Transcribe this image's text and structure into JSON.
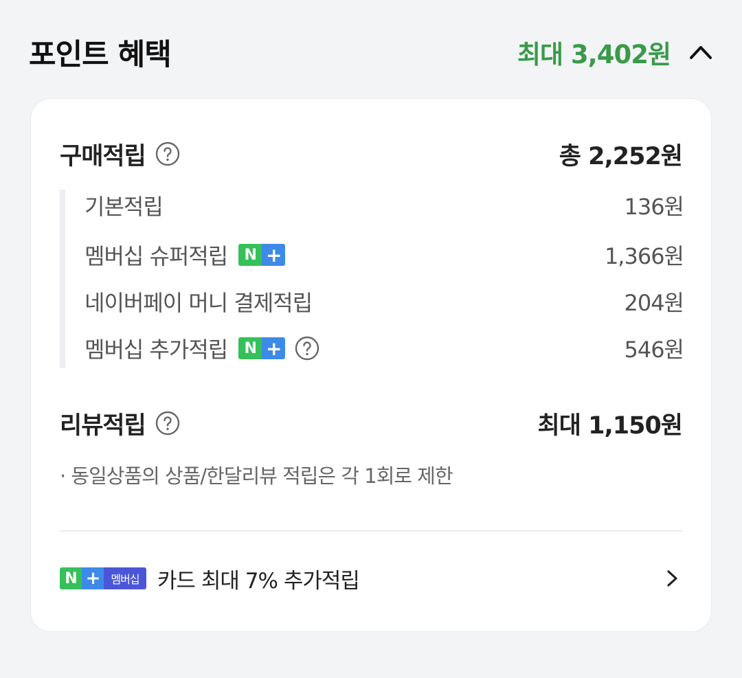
{
  "header": {
    "title": "포인트 혜택",
    "max_label": "최대 3,402원"
  },
  "purchase": {
    "label": "구매적립",
    "total": "총 2,252원",
    "items": [
      {
        "label": "기본적립",
        "amount": "136원"
      },
      {
        "label": "멤버십 슈퍼적립",
        "amount": "1,366원",
        "badge": "N+"
      },
      {
        "label": "네이버페이 머니 결제적립",
        "amount": "204원"
      },
      {
        "label": "멤버십 추가적립",
        "amount": "546원",
        "badge": "N+"
      }
    ]
  },
  "review": {
    "label": "리뷰적립",
    "total": "최대 1,150원",
    "note": "· 동일상품의 상품/한달리뷰 적립은 각 1회로 제한"
  },
  "promo": {
    "badge_n": "N",
    "badge_plus": "+",
    "badge_text": "멤버십",
    "text": "카드 최대 7% 추가적립"
  },
  "badge": {
    "n": "N",
    "plus": "+"
  },
  "icons": {
    "collapse": "chevron-up-icon",
    "help": "question-circle-icon",
    "promo_arrow": "chevron-right-icon"
  },
  "colors": {
    "accent_green": "#3a9a4a",
    "naver_green": "#35c05a",
    "plus_blue": "#3d8ae8",
    "membership_indigo": "#4a56d8"
  }
}
